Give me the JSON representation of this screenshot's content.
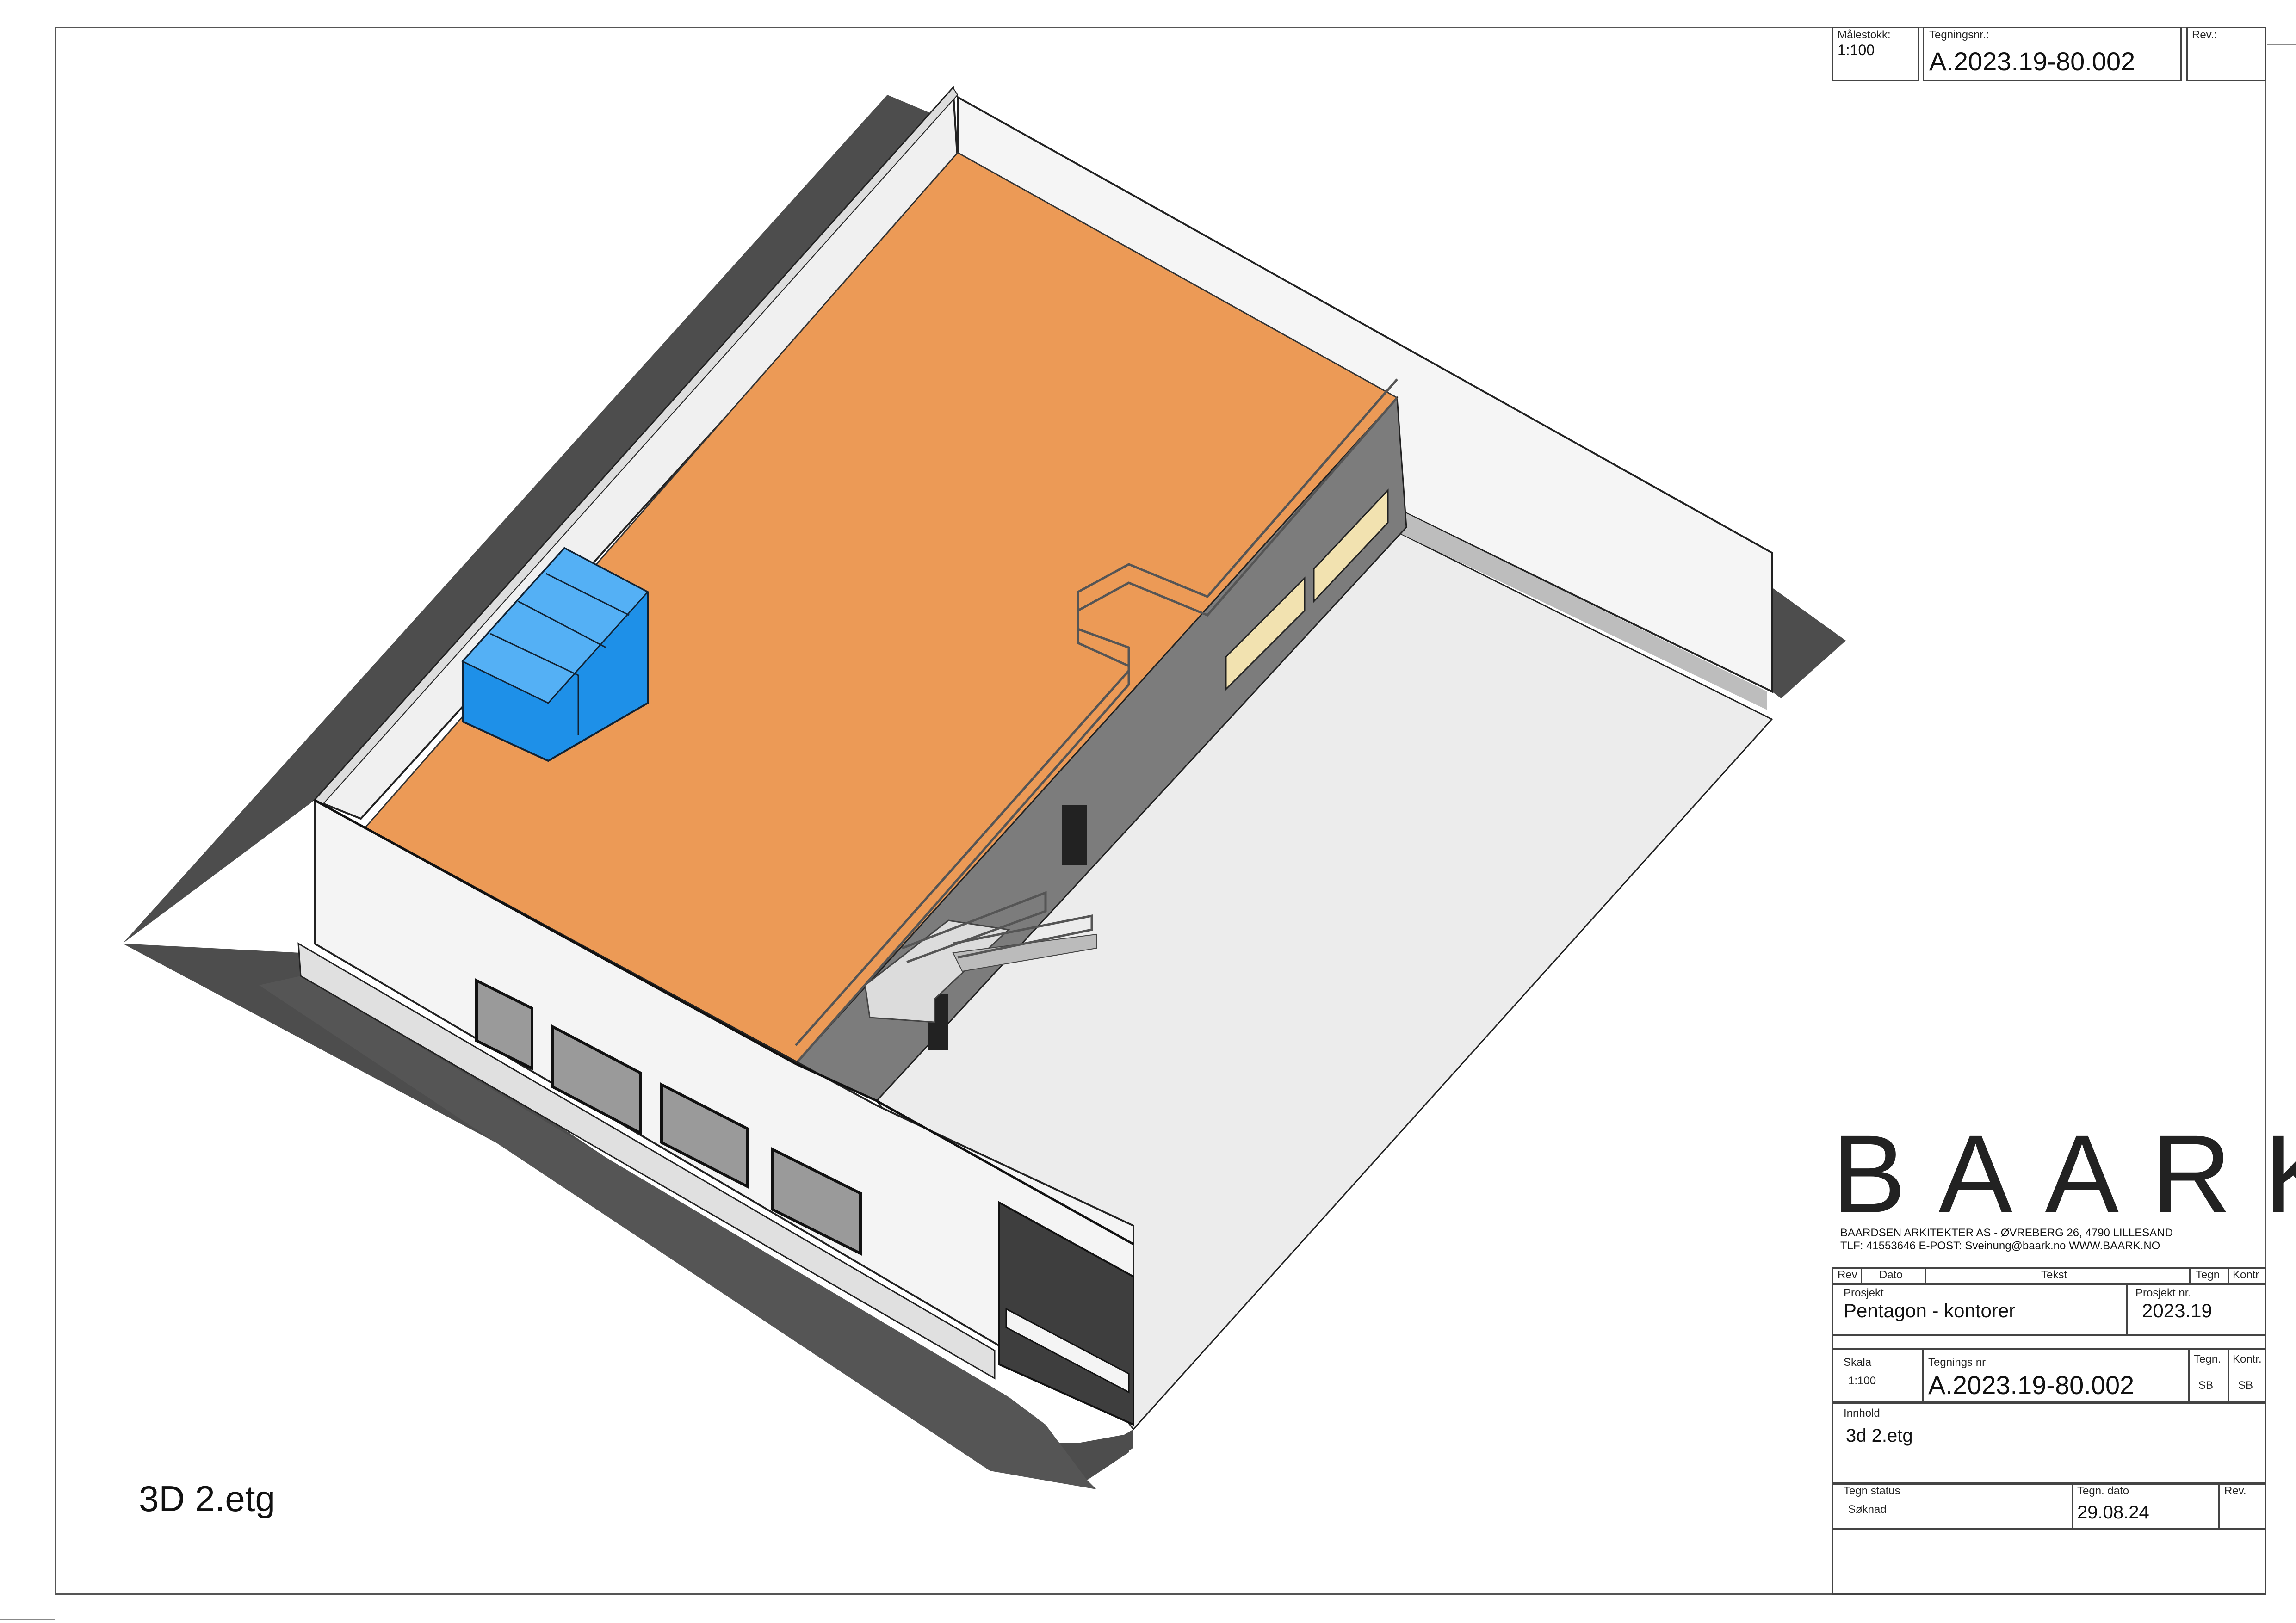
{
  "header": {
    "scale_label": "Målestokk:",
    "scale_value": "1:100",
    "drawing_no_label": "Tegningsnr.:",
    "drawing_no_value": "A.2023.19-80.002",
    "rev_label": "Rev.:"
  },
  "logo": {
    "text": "BAARK",
    "line1": "BAARDSEN ARKITEKTER AS - ØVREBERG 26, 4790 LILLESAND",
    "line2": "TLF: 41553646          E-POST: Sveinung@baark.no    WWW.BAARK.NO"
  },
  "revision_table": {
    "rev": "Rev",
    "dato": "Dato",
    "tekst": "Tekst",
    "tegn": "Tegn",
    "kontr": "Kontr"
  },
  "project": {
    "label": "Prosjekt",
    "value": "Pentagon - kontorer",
    "number_label": "Prosjekt  nr.",
    "number_value": "2023.19"
  },
  "drawing": {
    "scale_label": "Skala",
    "scale_value": "1:100",
    "no_label": "Tegnings nr",
    "no_value": "A.2023.19-80.002",
    "drawn_label": "Tegn.",
    "drawn_value": "SB",
    "checked_label": "Kontr.",
    "checked_value": "SB"
  },
  "content": {
    "label": "Innhold",
    "value": "3d 2.etg"
  },
  "status": {
    "label": "Tegn status",
    "value": "Søknad",
    "date_label": "Tegn. dato",
    "date_value": "29.08.24",
    "rev_label": "Rev."
  },
  "view_title": "3D 2.etg",
  "colors": {
    "roof": "#ec9a56",
    "hvac": "#1e90e8",
    "shadow": "#4d4d4d",
    "courtyard": "#ececec",
    "wall": "#f4f4f4",
    "inner_wall": "#7c7c7c"
  }
}
